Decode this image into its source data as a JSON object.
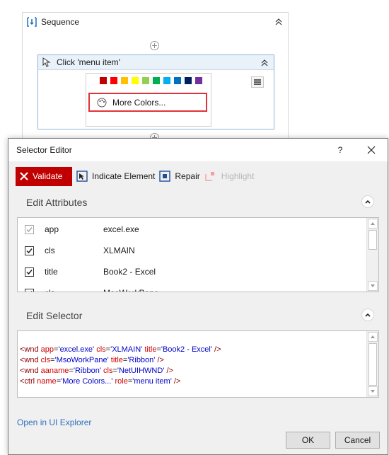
{
  "designer": {
    "sequence_title": "Sequence",
    "activity_title": "Click 'menu item'",
    "screenshot_label": "More Colors...",
    "swatch_colors": [
      "#c00000",
      "#ff0000",
      "#ffc000",
      "#ffff00",
      "#92d050",
      "#00b050",
      "#00b0f0",
      "#0070c0",
      "#002060",
      "#7030a0"
    ]
  },
  "dialog": {
    "title": "Selector Editor",
    "help_label": "?",
    "toolbar": {
      "validate_label": "Validate",
      "indicate_label": "Indicate Element",
      "repair_label": "Repair",
      "highlight_label": "Highlight"
    },
    "edit_attributes_title": "Edit Attributes",
    "attributes": [
      {
        "name": "app",
        "value": "excel.exe",
        "checked": true,
        "disabled": true
      },
      {
        "name": "cls",
        "value": "XLMAIN",
        "checked": true,
        "disabled": false
      },
      {
        "name": "title",
        "value": "Book2 - Excel",
        "checked": true,
        "disabled": false
      },
      {
        "name": "cls",
        "value": "MsoWorkPane",
        "checked": true,
        "disabled": false
      }
    ],
    "edit_selector_title": "Edit Selector",
    "selector_lines": [
      [
        [
          "t-tag",
          "<wnd "
        ],
        [
          "t-attr",
          "app"
        ],
        [
          "t-eq",
          "="
        ],
        [
          "t-val",
          "'excel.exe'"
        ],
        [
          "t-eq",
          " "
        ],
        [
          "t-attr",
          "cls"
        ],
        [
          "t-eq",
          "="
        ],
        [
          "t-val",
          "'XLMAIN'"
        ],
        [
          "t-eq",
          " "
        ],
        [
          "t-attr",
          "title"
        ],
        [
          "t-eq",
          "="
        ],
        [
          "t-val",
          "'Book2 - Excel'"
        ],
        [
          "t-tag",
          " />"
        ]
      ],
      [
        [
          "t-tag",
          "<wnd "
        ],
        [
          "t-attr",
          "cls"
        ],
        [
          "t-eq",
          "="
        ],
        [
          "t-val",
          "'MsoWorkPane'"
        ],
        [
          "t-eq",
          " "
        ],
        [
          "t-attr",
          "title"
        ],
        [
          "t-eq",
          "="
        ],
        [
          "t-val",
          "'Ribbon'"
        ],
        [
          "t-tag",
          " />"
        ]
      ],
      [
        [
          "t-tag",
          "<wnd "
        ],
        [
          "t-attr",
          "aaname"
        ],
        [
          "t-eq",
          "="
        ],
        [
          "t-val",
          "'Ribbon'"
        ],
        [
          "t-eq",
          " "
        ],
        [
          "t-attr",
          "cls"
        ],
        [
          "t-eq",
          "="
        ],
        [
          "t-val",
          "'NetUIHWND'"
        ],
        [
          "t-tag",
          " />"
        ]
      ],
      [
        [
          "t-tag",
          "<ctrl "
        ],
        [
          "t-attr",
          "name"
        ],
        [
          "t-eq",
          "="
        ],
        [
          "t-val",
          "'More Colors...'"
        ],
        [
          "t-eq",
          " "
        ],
        [
          "t-attr",
          "role"
        ],
        [
          "t-eq",
          "="
        ],
        [
          "t-val",
          "'menu item'"
        ],
        [
          "t-tag",
          " />"
        ]
      ]
    ],
    "open_explorer_label": "Open in UI Explorer",
    "ok_label": "OK",
    "cancel_label": "Cancel"
  }
}
